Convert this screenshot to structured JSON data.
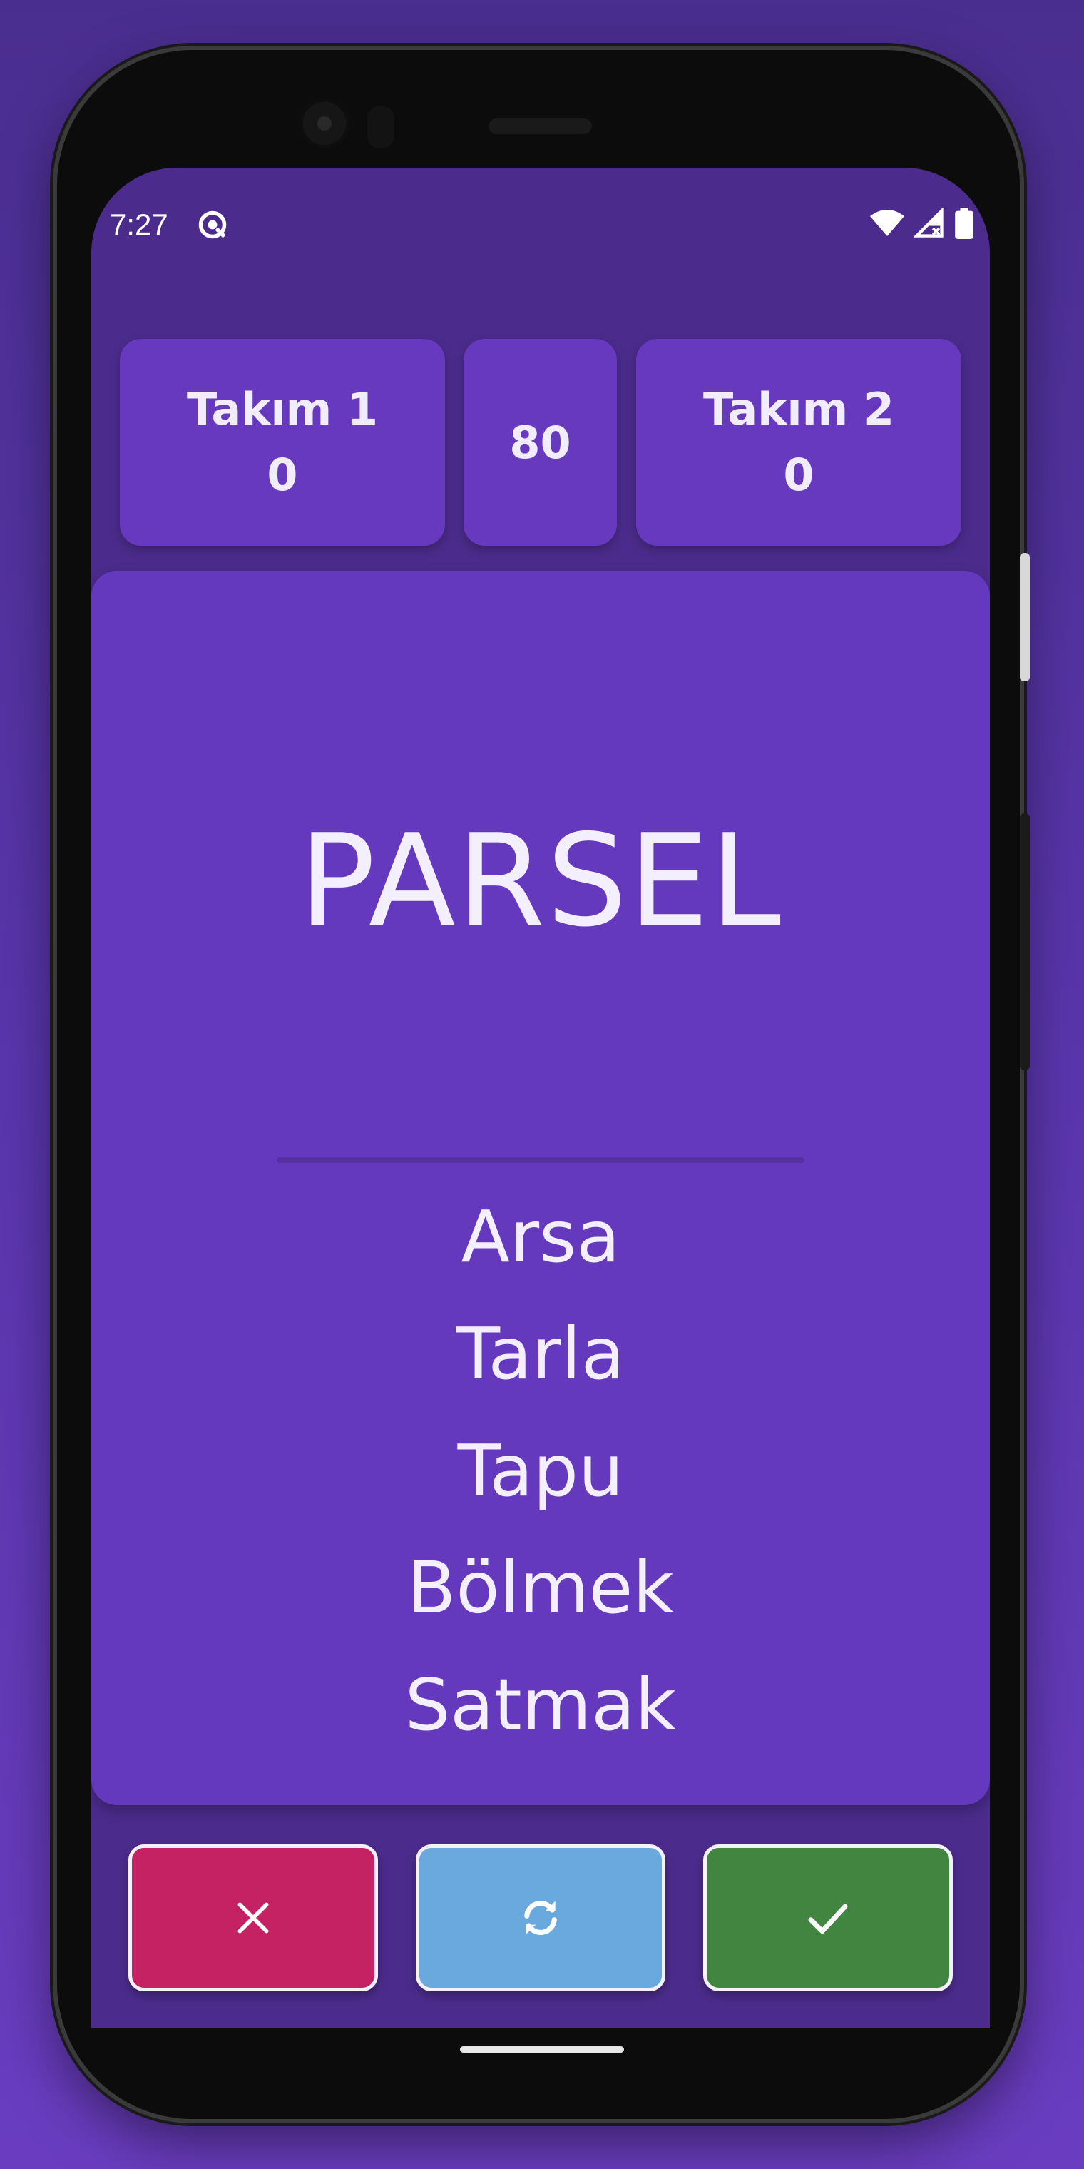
{
  "status_bar": {
    "time": "7:27",
    "app_icon": "auto-rotate-icon",
    "icons": [
      "wifi-icon",
      "signal-icon",
      "battery-icon"
    ]
  },
  "scoreboard": {
    "team1": {
      "name": "Takım 1",
      "score": "0"
    },
    "timer": "80",
    "team2": {
      "name": "Takım 2",
      "score": "0"
    }
  },
  "card": {
    "word": "PARSEL",
    "forbidden": [
      "Arsa",
      "Tarla",
      "Tapu",
      "Bölmek",
      "Satmak"
    ]
  },
  "actions": {
    "pass": {
      "icon": "close-icon",
      "color": "#c42263"
    },
    "skip": {
      "icon": "refresh-icon",
      "color": "#6aa9de"
    },
    "correct": {
      "icon": "check-icon",
      "color": "#418541"
    }
  },
  "colors": {
    "background": "#5a36ad",
    "card": "#6539be",
    "screen": "#4b2c8c"
  }
}
